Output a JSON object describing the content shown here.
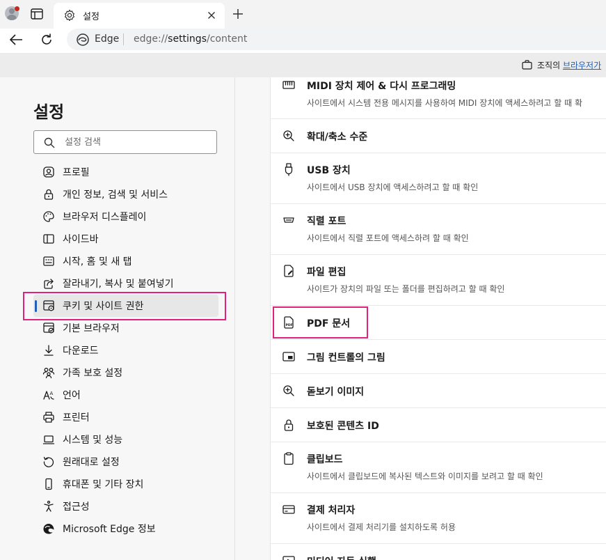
{
  "browser": {
    "tab_title": "설정",
    "address_site": "Edge",
    "address_prefix": "edge://",
    "address_path_bold": "settings",
    "address_rest": "/content"
  },
  "managed_banner": {
    "text": "조직의 ",
    "link": "브라우저가"
  },
  "sidebar": {
    "title": "설정",
    "search_placeholder": "설정 검색",
    "items": [
      {
        "label": "프로필",
        "icon": "profile-icon"
      },
      {
        "label": "개인 정보, 검색 및 서비스",
        "icon": "lock-icon"
      },
      {
        "label": "브라우저 디스플레이",
        "icon": "palette-icon"
      },
      {
        "label": "사이드바",
        "icon": "sidebar-icon"
      },
      {
        "label": "시작, 홈 및 새 탭",
        "icon": "home-icon"
      },
      {
        "label": "잘라내기, 복사 및 붙여넣기",
        "icon": "share-icon"
      },
      {
        "label": "쿠키 및 사이트 권한",
        "icon": "cookie-permissions-icon",
        "active": true
      },
      {
        "label": "기본 브라우저",
        "icon": "default-browser-icon"
      },
      {
        "label": "다운로드",
        "icon": "download-icon"
      },
      {
        "label": "가족 보호 설정",
        "icon": "family-icon"
      },
      {
        "label": "언어",
        "icon": "language-icon"
      },
      {
        "label": "프린터",
        "icon": "printer-icon"
      },
      {
        "label": "시스템 및 성능",
        "icon": "laptop-icon"
      },
      {
        "label": "원래대로 설정",
        "icon": "reset-icon"
      },
      {
        "label": "휴대폰 및 기타 장치",
        "icon": "phone-icon"
      },
      {
        "label": "접근성",
        "icon": "accessibility-icon"
      },
      {
        "label": "Microsoft Edge 정보",
        "icon": "edge-logo-icon"
      }
    ]
  },
  "main": {
    "rows": [
      {
        "title": "MIDI 장치 제어 & 다시 프로그래밍",
        "desc": "사이트에서 시스템 전용 메시지를 사용하여 MIDI 장치에 액세스하려고 할 때 확",
        "icon": "midi-icon"
      },
      {
        "title": "확대/축소 수준",
        "desc": "",
        "icon": "zoom-icon"
      },
      {
        "title": "USB 장치",
        "desc": "사이트에서 USB 장치에 액세스하려고 할 때 확인",
        "icon": "usb-icon"
      },
      {
        "title": "직렬 포트",
        "desc": "사이트에서 직렬 포트에 액세스하려 할 때 확인",
        "icon": "serial-port-icon"
      },
      {
        "title": "파일 편집",
        "desc": "사이트가 장치의 파일 또는 폴더를 편집하려고 할 때 확인",
        "icon": "file-edit-icon"
      },
      {
        "title": "PDF 문서",
        "desc": "",
        "icon": "pdf-icon"
      },
      {
        "title": "그림 컨트롤의 그림",
        "desc": "",
        "icon": "pip-icon"
      },
      {
        "title": "돋보기 이미지",
        "desc": "",
        "icon": "magnifier-icon"
      },
      {
        "title": "보호된 콘텐츠 ID",
        "desc": "",
        "icon": "protected-content-icon"
      },
      {
        "title": "클립보드",
        "desc": "사이트에서 클립보드에 복사된 텍스트와 이미지를 보려고 할 때 확인",
        "icon": "clipboard-icon"
      },
      {
        "title": "결제 처리자",
        "desc": "사이트에서 결제 처리기를 설치하도록 허용",
        "icon": "payment-icon"
      },
      {
        "title": "미디어 자동 실행",
        "desc": "",
        "icon": "media-autoplay-icon"
      }
    ]
  },
  "colors": {
    "accent": "#1f5fb8",
    "highlight": "#e0227e"
  }
}
